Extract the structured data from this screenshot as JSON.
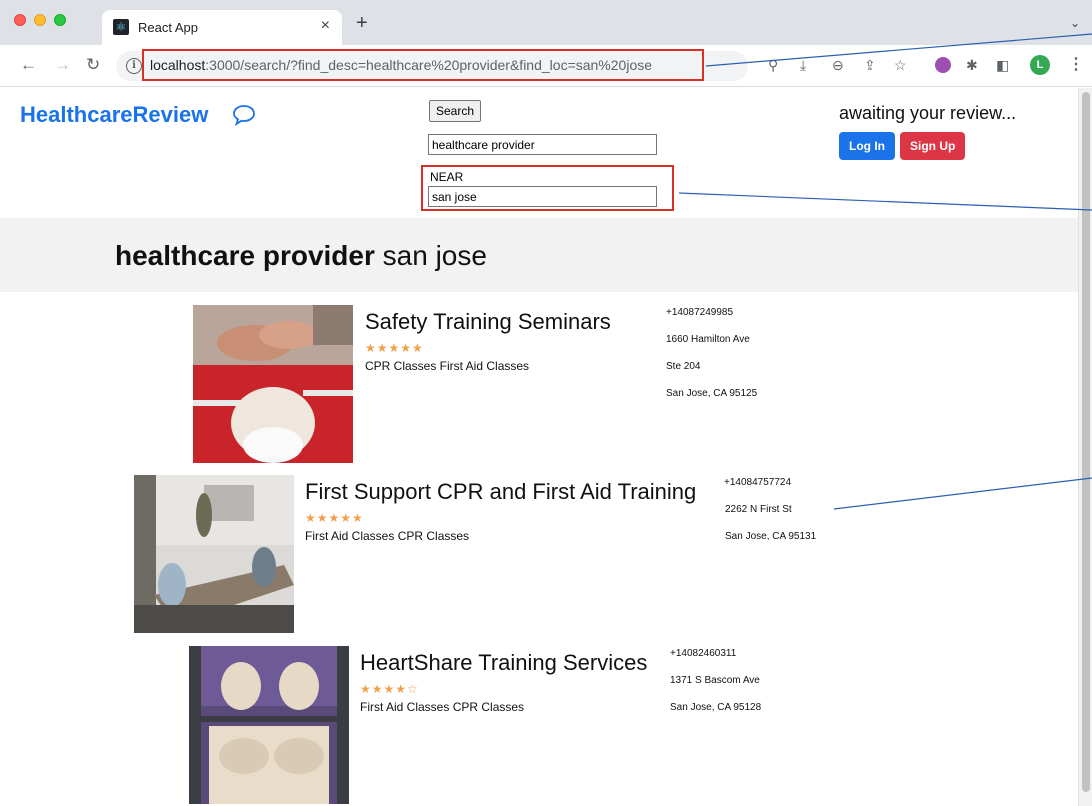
{
  "browser": {
    "tab_title": "React App",
    "tab_close": "×",
    "new_tab": "+",
    "url_host": "localhost",
    "url_rest": ":3000/search/?find_desc=healthcare%20provider&find_loc=san%20jose",
    "avatar_initial": "L"
  },
  "header": {
    "logo": "HealthcareReview",
    "search_button": "Search",
    "find_desc_value": "healthcare provider",
    "near_label": "NEAR",
    "find_loc_value": "san jose",
    "awaiting": "awaiting your review...",
    "login": "Log In",
    "signup": "Sign Up"
  },
  "banner": {
    "term": "healthcare provider",
    "location": "san jose"
  },
  "results": [
    {
      "name": "Safety Training Seminars",
      "stars": "★★★★★",
      "rating": 5,
      "categories": "CPR Classes First Aid Classes",
      "phone": "+14087249985",
      "address1": "1660 Hamilton Ave",
      "address2": "Ste 204",
      "city": "San Jose, CA 95125"
    },
    {
      "name": "First Support CPR and First Aid Training",
      "stars": "★★★★★",
      "rating": 5,
      "categories": "First Aid Classes CPR Classes",
      "phone": "+14084757724",
      "address1": "2262 N First St",
      "city": "San Jose, CA 95131"
    },
    {
      "name": "HeartShare Training Services",
      "stars": "★★★★☆",
      "rating": 4,
      "categories": "First Aid Classes CPR Classes",
      "phone": "+14082460311",
      "address1": "1371 S Bascom Ave",
      "city": "San Jose, CA 95128"
    }
  ],
  "colors": {
    "brand": "#1a73e8",
    "signup": "#dc3545",
    "annotation_box": "#d93025",
    "annotation_line": "#2b5fb3",
    "stars": "#f0a04b"
  }
}
